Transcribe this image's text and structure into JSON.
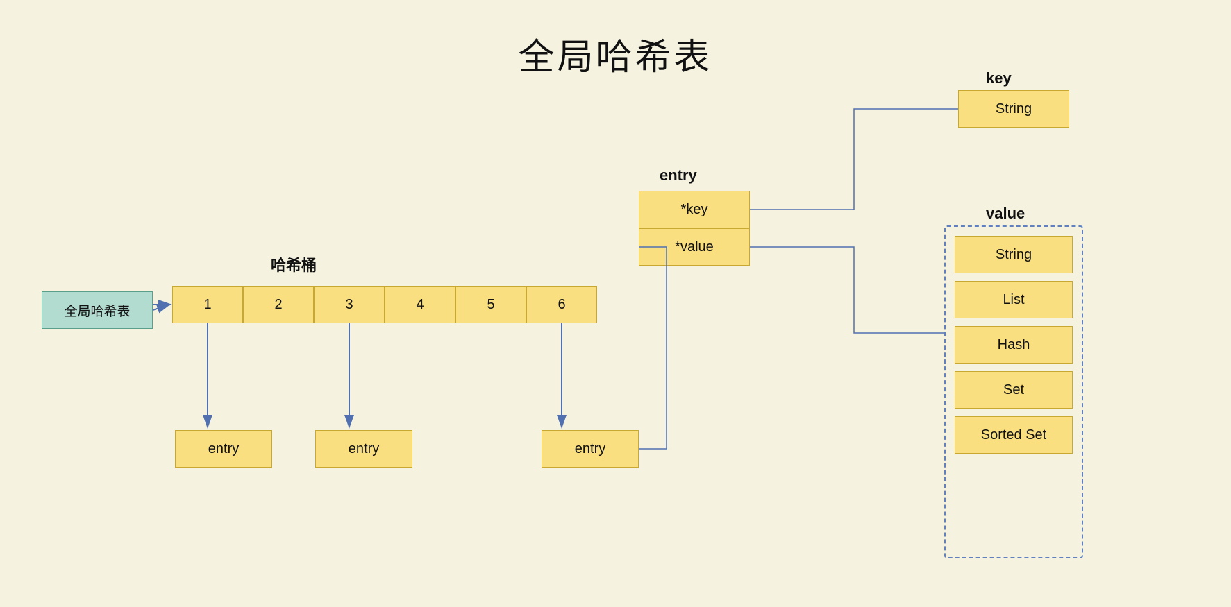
{
  "title": "全局哈希表",
  "global_label": "全局哈希表",
  "hash_bucket_label": "哈希桶",
  "entry_label": "entry",
  "bucket_cells": [
    "1",
    "2",
    "3",
    "4",
    "5",
    "6"
  ],
  "entry_fields": [
    "*key",
    "*value"
  ],
  "key_label": "key",
  "value_label": "value",
  "key_type": "String",
  "value_types": [
    "String",
    "List",
    "Hash",
    "Set",
    "Sorted Set"
  ],
  "entry_boxes": [
    "entry",
    "entry",
    "entry"
  ]
}
